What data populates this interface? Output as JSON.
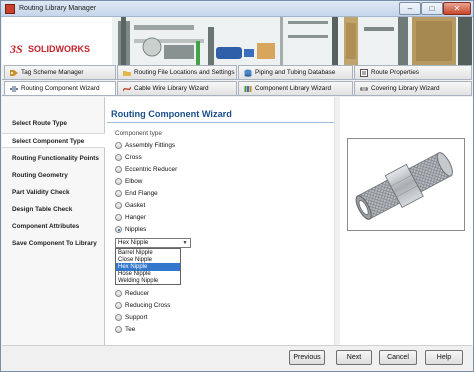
{
  "window": {
    "title": "Routing Library Manager",
    "controls": [
      "–",
      "□",
      "✕"
    ]
  },
  "brand": {
    "ds": "3S",
    "name": "SOLIDWORKS",
    "color": "#c3242b"
  },
  "tabs_top": [
    {
      "label": "Tag Scheme Manager",
      "icon": "tag-icon"
    },
    {
      "label": "Routing File Locations and Settings",
      "icon": "folder-icon"
    },
    {
      "label": "Piping and Tubing Database",
      "icon": "database-icon"
    },
    {
      "label": "Route Properties",
      "icon": "properties-icon"
    }
  ],
  "tabs_bottom": [
    {
      "label": "Routing Component Wizard",
      "icon": "wizard-icon",
      "active": true
    },
    {
      "label": "Cable Wire Library Wizard",
      "icon": "cable-icon"
    },
    {
      "label": "Component Library Wizard",
      "icon": "library-icon"
    },
    {
      "label": "Covering Library Wizard",
      "icon": "covering-icon"
    }
  ],
  "steps": [
    {
      "label": "Select Route Type"
    },
    {
      "label": "Select Component Type",
      "active": true
    },
    {
      "label": "Routing Functionality Points"
    },
    {
      "label": "Routing Geometry"
    },
    {
      "label": "Part Validity Check"
    },
    {
      "label": "Design Table Check"
    },
    {
      "label": "Component Attributes"
    },
    {
      "label": "Save Component To Library"
    }
  ],
  "main": {
    "title": "Routing Component Wizard",
    "group_label": "Component type",
    "radios_top": [
      {
        "label": "Assembly Fittings"
      },
      {
        "label": "Cross"
      },
      {
        "label": "Eccentric Reducer"
      },
      {
        "label": "Elbow"
      },
      {
        "label": "End Flange"
      },
      {
        "label": "Gasket"
      },
      {
        "label": "Hanger"
      },
      {
        "label": "Nipples",
        "selected": true
      }
    ],
    "subtype_value": "Hex Nipple",
    "subtype_options": [
      {
        "label": "Barrel Nipple"
      },
      {
        "label": "Close Nipple"
      },
      {
        "label": "Hex Nipple",
        "selected": true
      },
      {
        "label": "Hose Nipple"
      },
      {
        "label": "Welding Nipple"
      }
    ],
    "radios_bottom": [
      {
        "label": "Reducer"
      },
      {
        "label": "Reducing Cross"
      },
      {
        "label": "Support"
      },
      {
        "label": "Tee"
      }
    ],
    "accent": "#1a4f8b"
  },
  "footer": {
    "previous": "Previous",
    "next": "Next",
    "cancel": "Cancel",
    "help": "Help"
  }
}
